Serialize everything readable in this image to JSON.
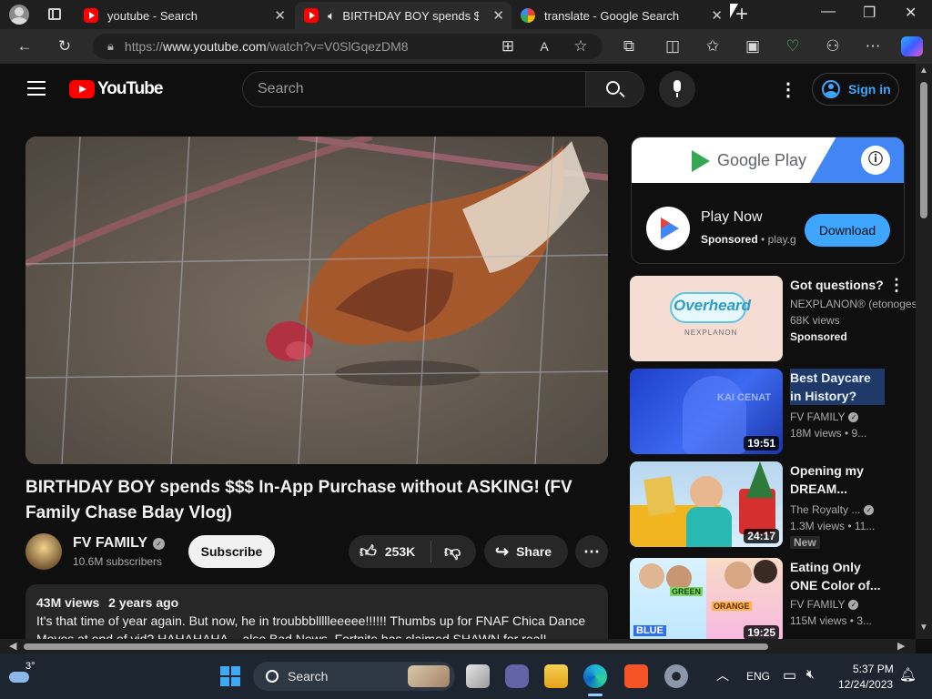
{
  "browser": {
    "tabs": [
      {
        "title": "youtube - Search"
      },
      {
        "title": "BIRTHDAY BOY spends $$$"
      },
      {
        "title": "translate - Google Search"
      }
    ],
    "url_prefix": "https://",
    "url_host": "www.youtube.com",
    "url_path": "/watch?v=V0SlGqezDM8"
  },
  "youtube": {
    "logo_text": "YouTube",
    "search_placeholder": "Search",
    "sign_in_label": "Sign in",
    "video_title": "BIRTHDAY BOY spends $$$ In-App Purchase without ASKING! (FV Family Chase Bday Vlog)",
    "channel_name": "FV FAMILY",
    "subscribers": "10.6M subscribers",
    "subscribe_label": "Subscribe",
    "likes": "253K",
    "share_label": "Share",
    "description": {
      "views": "43M views",
      "age": "2 years ago",
      "text": "It's that time of year again.  But now, he in troubbbllllleeeee!!!!!!  Thumbs up for FNAF Chica Dance Moves at end of vid? HAHAHAHA... also Bad News, Fortnite has claimed SHAWN for real!"
    }
  },
  "ad": {
    "brand": "Google Play",
    "title": "Play Now",
    "sponsored": "Sponsored",
    "domain": "play.g",
    "cta": "Download"
  },
  "recommendations": [
    {
      "title": "Got questions?",
      "channel": "NEXPLANON® (etonoges",
      "meta": "68K views",
      "badge": "Sponsored",
      "thumb_text": "Overheard",
      "thumb_sub": "NEXPLANON",
      "duration": ""
    },
    {
      "title": "Best Daycare in History? Kai...",
      "channel": "FV FAMILY",
      "meta": "18M views • 9...",
      "badge": "",
      "thumb_text": "KAI CENAT",
      "thumb_sub": "",
      "duration": "19:51"
    },
    {
      "title": "Opening my DREAM...",
      "channel": "The Royalty ...",
      "meta": "1.3M views • 11...",
      "badge": "New",
      "thumb_text": "",
      "thumb_sub": "",
      "duration": "24:17"
    },
    {
      "title": "Eating Only ONE Color of...",
      "channel": "FV FAMILY",
      "meta": "115M views • 3...",
      "badge": "",
      "thumb_text": "GREEN",
      "thumb_sub": "ORANGE",
      "thumb_sub2": "BLUE",
      "duration": "19:25"
    }
  ],
  "taskbar": {
    "weather_temp": "3°",
    "search_label": "Search",
    "language": "ENG",
    "time": "5:37 PM",
    "date": "12/24/2023"
  }
}
